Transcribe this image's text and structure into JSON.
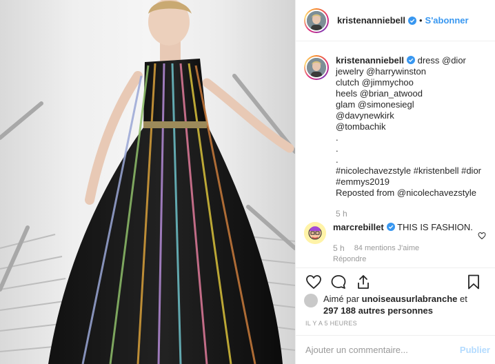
{
  "post": {
    "author": "kristenanniebell",
    "follow_label": "S'abonner",
    "separator": "•"
  },
  "caption": {
    "author": "kristenanniebell",
    "lines": [
      "dress @dior",
      "jewelry @harrywinston",
      "clutch @jimmychoo",
      "heels @brian_atwood",
      "glam @simonesiegl",
      "@davynewkirk",
      "@tombachik",
      ".",
      ".",
      ".",
      "#nicolechavezstyle #kristenbell #dior",
      "#emmys2019",
      "Reposted from @nicolechavezstyle"
    ],
    "time": "5 h"
  },
  "comment": {
    "author": "marcrebillet",
    "text": "THIS IS FASHION.",
    "time": "5 h",
    "likes": "84 mentions J'aime",
    "reply": "Répondre"
  },
  "likes": {
    "prefix": "Aimé par",
    "user": "unoiseausurlabranche",
    "connector": "et",
    "count": "297 188 autres personnes"
  },
  "timestamp": "IL Y A 5 HEURES",
  "add_comment": {
    "placeholder": "Ajouter un commentaire...",
    "publish_label": "Publier"
  },
  "colors": {
    "link": "#3897f0",
    "verified": "#3897f0",
    "muted": "#999999",
    "publish_disabled": "#b3dbff"
  }
}
